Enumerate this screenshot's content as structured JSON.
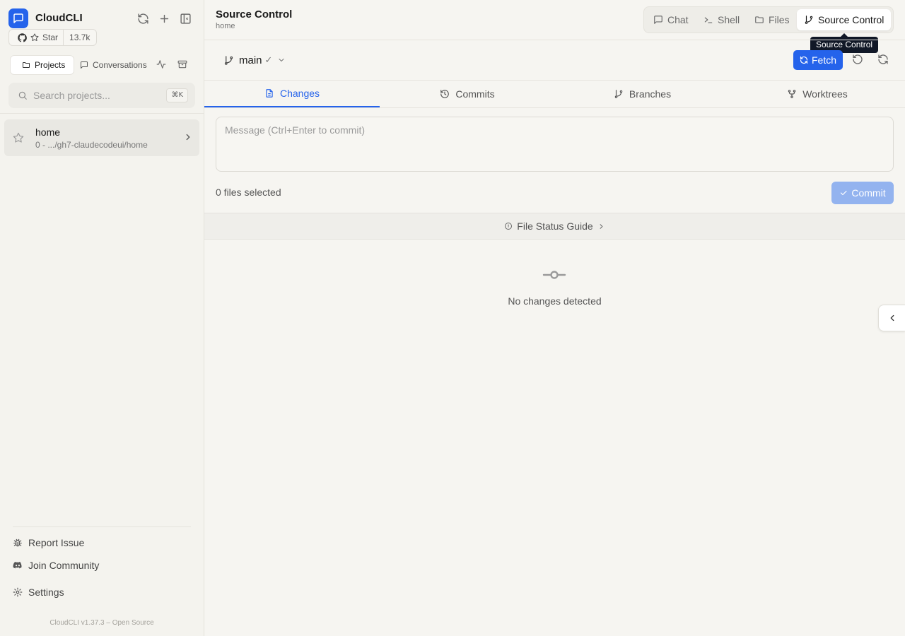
{
  "app": {
    "name": "CloudCLI",
    "brand_color": "#2563eb"
  },
  "github": {
    "star_label": "Star",
    "star_count": "13.7k"
  },
  "sidebar": {
    "tabs": [
      {
        "label": "Projects",
        "active": true
      },
      {
        "label": "Conversations",
        "active": false
      }
    ],
    "search": {
      "placeholder": "Search projects...",
      "shortcut": "⌘K"
    },
    "projects": [
      {
        "name": "home",
        "meta": "0  - .../gh7-claudecodeui/home",
        "starred": false
      }
    ],
    "footer_links": {
      "report": "Report Issue",
      "community": "Join Community",
      "settings": "Settings"
    },
    "version": "CloudCLI v1.37.3 – Open Source"
  },
  "header": {
    "title": "Source Control",
    "subtitle": "home",
    "view_tabs": [
      {
        "label": "Chat"
      },
      {
        "label": "Shell"
      },
      {
        "label": "Files"
      },
      {
        "label": "Source Control",
        "active": true
      }
    ],
    "tooltip": "Source Control"
  },
  "source_control": {
    "branch": "main",
    "branch_status": "✓",
    "fetch_label": "Fetch",
    "tabs": [
      {
        "label": "Changes",
        "active": true
      },
      {
        "label": "Commits"
      },
      {
        "label": "Branches"
      },
      {
        "label": "Worktrees"
      }
    ],
    "message_placeholder": "Message (Ctrl+Enter to commit)",
    "files_selected": "0 files selected",
    "commit_label": "Commit",
    "guide_label": "File Status Guide",
    "empty_text": "No changes detected"
  }
}
